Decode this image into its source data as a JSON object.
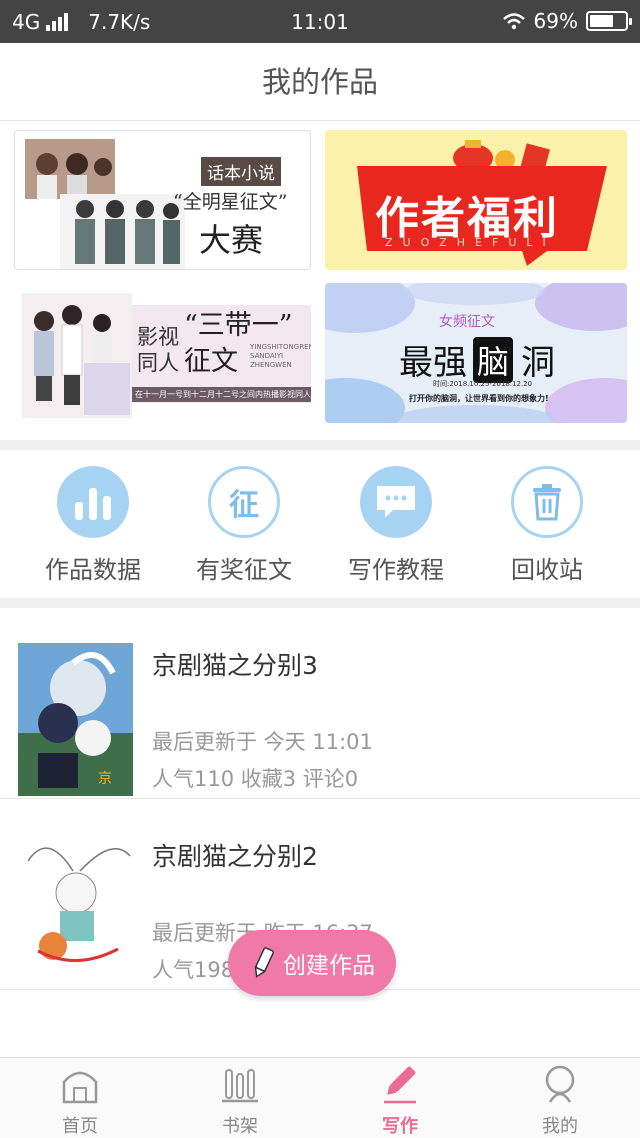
{
  "status_bar": {
    "network": "4G",
    "speed": "7.7K/s",
    "time": "11:01",
    "battery": "69%",
    "battery_level": 0.69
  },
  "header": {
    "title": "我的作品"
  },
  "banners": {
    "b1": {
      "tag": "话本小说",
      "quote": "“全明星征文”",
      "big": "大赛"
    },
    "b2": {
      "title": "作者福利",
      "pinyin": "ZUOZHEFULI"
    },
    "b3": {
      "line1": "影视",
      "line2": "同人",
      "quote": "“三带一”",
      "big": "征文",
      "pinyin": "YINGSHITONGREN SANDAIYI ZHENGWEN",
      "note": "在十一月一号到十二月十二号之间内热播影视同人征文"
    },
    "b4": {
      "tag": "女频征文",
      "title1": "最强",
      "title2": "脑",
      "title3": "洞",
      "date": "时间:2018.10.25-2018.12.20",
      "slogan": "打开你的脑洞，让世界看到你的想象力!"
    }
  },
  "menu": [
    {
      "label": "作品数据",
      "icon": "bar-chart-icon"
    },
    {
      "label": "有奖征文",
      "icon": "contest-icon",
      "glyph": "征"
    },
    {
      "label": "写作教程",
      "icon": "chat-bubble-icon"
    },
    {
      "label": "回收站",
      "icon": "trash-icon"
    }
  ],
  "works": [
    {
      "title": "京剧猫之分别3",
      "updated": "最后更新于 今天 11:01",
      "stats": "人气110 收藏3 评论0"
    },
    {
      "title": "京剧猫之分别2",
      "updated": "最后更新于 昨天 16:37",
      "stats": "人气198 收藏3 评论1"
    }
  ],
  "fab": {
    "label": "创建作品",
    "icon": "pencil-icon"
  },
  "tabbar": [
    {
      "label": "首页",
      "icon": "home-icon"
    },
    {
      "label": "书架",
      "icon": "bookshelf-icon"
    },
    {
      "label": "写作",
      "icon": "pencil-icon",
      "active": true
    },
    {
      "label": "我的",
      "icon": "profile-icon"
    }
  ],
  "colors": {
    "accent": "#e96c95",
    "fab": "#f179a8",
    "menu_icon": "#a7d3f2",
    "banner_red": "#e8281f"
  }
}
